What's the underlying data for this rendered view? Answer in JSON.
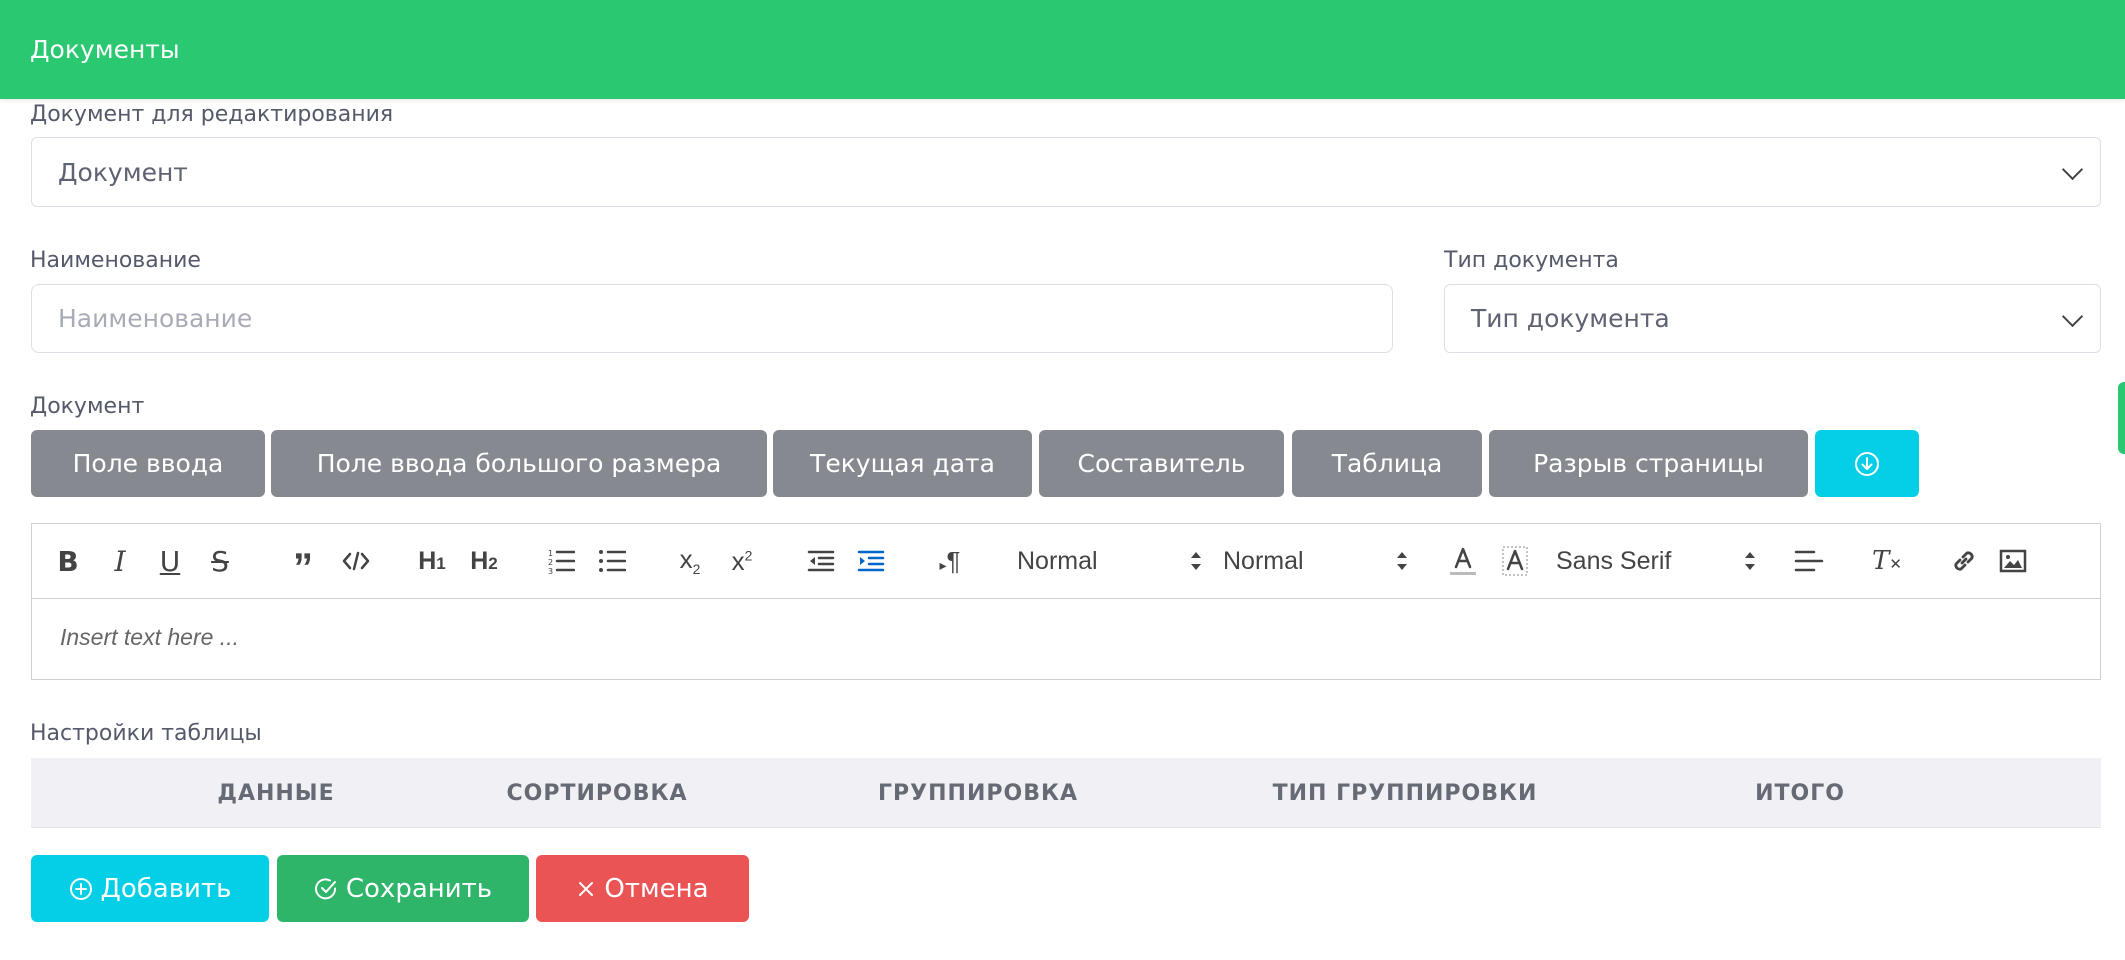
{
  "header": {
    "title": "Документы"
  },
  "doc_select": {
    "label": "Документ для редактирования",
    "value": "Документ"
  },
  "name_field": {
    "label": "Наименование",
    "placeholder": "Наименование"
  },
  "type_select": {
    "label": "Тип документа",
    "value": "Тип документа"
  },
  "document": {
    "label": "Документ",
    "insert_buttons": [
      "Поле ввода",
      "Поле ввода большого размера",
      "Текущая дата",
      "Составитель",
      "Таблица",
      "Разрыв страницы"
    ]
  },
  "editor": {
    "header_picker": "Normal",
    "size_picker": "Normal",
    "font_picker": "Sans Serif",
    "placeholder": "Insert text here ..."
  },
  "table_settings": {
    "label": "Настройки таблицы",
    "columns": [
      "ДАННЫЕ",
      "СОРТИРОВКА",
      "ГРУППИРОВКА",
      "ТИП ГРУППИРОВКИ",
      "ИТОГО"
    ]
  },
  "actions": {
    "add": "Добавить",
    "save": "Сохранить",
    "cancel": "Отмена"
  },
  "colors": {
    "header": "#2ac870",
    "gray_button": "#868a90",
    "cyan": "#05cfe6",
    "save": "#2fb56a",
    "cancel": "#ea5455",
    "active_icon": "#0066cc"
  }
}
